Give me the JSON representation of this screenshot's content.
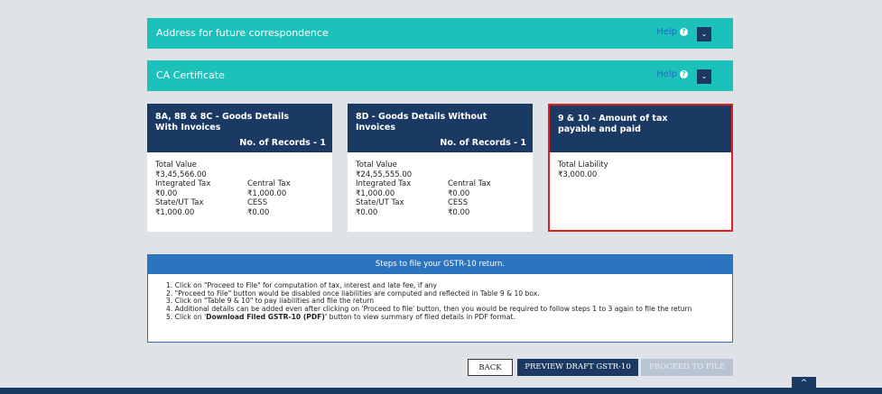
{
  "panels": [
    {
      "title": "Address for future correspondence",
      "help": "Help",
      "help_icon": "?",
      "toggle_icon": "⌄"
    },
    {
      "title": "CA Certificate",
      "help": "Help",
      "help_icon": "?",
      "toggle_icon": "⌄"
    }
  ],
  "tiles": [
    {
      "title": "8A, 8B & 8C - Goods Details With Invoices",
      "records": "No. of Records - 1",
      "total_value_label": "Total Value",
      "total_value": "₹3,45,566.00",
      "igst_label": "Integrated Tax",
      "cgst_label": "Central Tax",
      "igst": "₹0.00",
      "cgst": "₹1,000.00",
      "sgst_label": "State/UT Tax",
      "cess_label": "CESS",
      "sgst": "₹1,000.00",
      "cess": "₹0.00"
    },
    {
      "title": "8D - Goods Details Without Invoices",
      "records": "No. of Records - 1",
      "total_value_label": "Total Value",
      "total_value": "₹24,55,555.00",
      "igst_label": "Integrated Tax",
      "cgst_label": "Central Tax",
      "igst": "₹1,000.00",
      "cgst": "₹0.00",
      "sgst_label": "State/UT Tax",
      "cess_label": "CESS",
      "sgst": "₹0.00",
      "cess": "₹0.00"
    },
    {
      "title": "9 & 10 - Amount of tax payable and paid",
      "total_liability_label": "Total Liability",
      "total_liability": "₹3,000.00"
    }
  ],
  "steps": {
    "heading": "Steps to file your GSTR-10 return.",
    "items": [
      "1. Click on \"Proceed to File\" for computation of tax, interest and late fee, if any",
      "2. \"Proceed to File\" button would be disabled once liabilities are computed and reflected in Table 9 & 10 box.",
      "3. Click on \"Table 9 & 10\" to pay liabilities and file the return",
      "4. Additional details can be added even after clicking on 'Proceed to file' button, then you would be required to follow steps 1 to 3 again to file the return"
    ],
    "item5_prefix": "5. Click on '",
    "item5_bold": "Download Filed GSTR-10 (PDF)'",
    "item5_suffix": " button to view summary of filed details in PDF format."
  },
  "buttons": {
    "back": "BACK",
    "preview": "PREVIEW DRAFT GSTR-10",
    "proceed": "PROCEED TO FILE"
  },
  "scroll_top_icon": "^",
  "colors": {
    "teal": "#1cc1b9",
    "navy": "#1b3a63",
    "blue": "#2d74be",
    "highlight": "#e02020"
  }
}
